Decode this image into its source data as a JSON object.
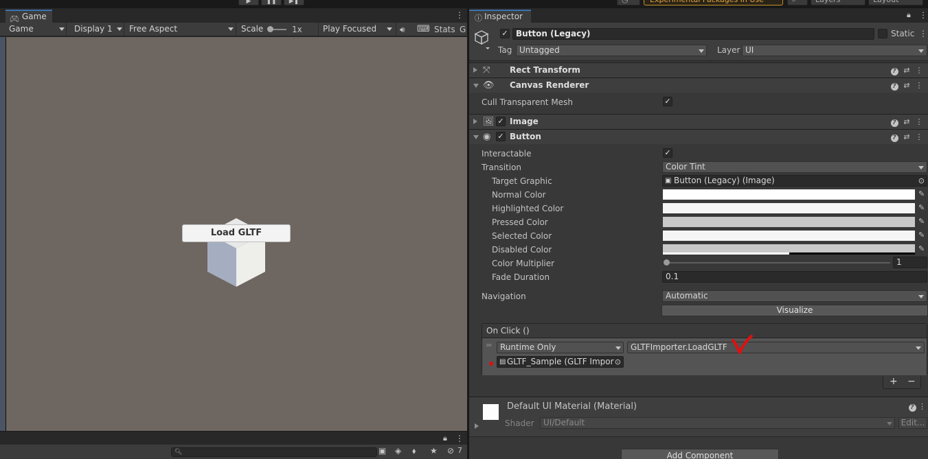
{
  "toolbar": {
    "experimental_label": "Experimental Packages In Use",
    "layers_label": "Layers",
    "layout_label": "Layout"
  },
  "game": {
    "tab_label": "Game",
    "mode_dropdown": "Game",
    "display_dropdown": "Display 1",
    "aspect_dropdown": "Free Aspect",
    "scale_label": "Scale",
    "scale_value": "1x",
    "play_mode_dropdown": "Play Focused",
    "stats_label": "Stats",
    "gizmos_label": "G",
    "load_button": "Load GLTF",
    "hidden_count": "7"
  },
  "inspector": {
    "tab_label": "Inspector",
    "object_name": "Button (Legacy)",
    "static_label": "Static",
    "tag_label": "Tag",
    "tag_value": "Untagged",
    "layer_label": "Layer",
    "layer_value": "UI",
    "rect_transform": {
      "title": "Rect Transform"
    },
    "canvas_renderer": {
      "title": "Canvas Renderer",
      "cull_label": "Cull Transparent Mesh",
      "cull_checked": true
    },
    "image": {
      "title": "Image"
    },
    "button": {
      "title": "Button",
      "interactable_label": "Interactable",
      "transition_label": "Transition",
      "transition_value": "Color Tint",
      "target_graphic_label": "Target Graphic",
      "target_graphic_value": "Button (Legacy) (Image)",
      "colors": [
        {
          "label": "Normal Color",
          "color": "#ffffff"
        },
        {
          "label": "Highlighted Color",
          "color": "#f5f5f5"
        },
        {
          "label": "Pressed Color",
          "color": "#c8c8c8"
        },
        {
          "label": "Selected Color",
          "color": "#f5f5f5"
        },
        {
          "label": "Disabled Color",
          "color": "#c8c8c8"
        }
      ],
      "color_multiplier_label": "Color Multiplier",
      "color_multiplier_value": "1",
      "fade_duration_label": "Fade Duration",
      "fade_duration_value": "0.1",
      "navigation_label": "Navigation",
      "navigation_value": "Automatic",
      "visualize_button": "Visualize",
      "onclick": {
        "title": "On Click ()",
        "runtime_value": "Runtime Only",
        "function_value": "GLTFImporter.LoadGLTF",
        "object_value": "GLTF_Sample (GLTF Import"
      }
    },
    "material": {
      "title": "Default UI Material (Material)",
      "shader_label": "Shader",
      "shader_value": "UI/Default",
      "edit_button": "Edit..."
    },
    "add_component_button": "Add Component"
  }
}
